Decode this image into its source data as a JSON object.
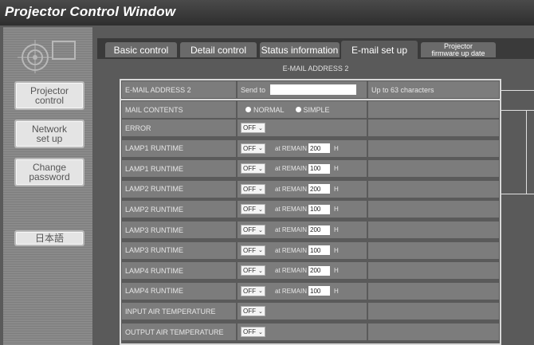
{
  "window": {
    "title": "Projector Control Window"
  },
  "sidebar": {
    "buttons": [
      {
        "label": "Projector\ncontrol"
      },
      {
        "label": "Network\nset up"
      },
      {
        "label": "Change\npassword"
      },
      {
        "label": "日本語"
      }
    ]
  },
  "tabs": [
    {
      "label": "Basic control"
    },
    {
      "label": "Detail control"
    },
    {
      "label": "Status information"
    },
    {
      "label": "E-mail set up",
      "active": true
    },
    {
      "label": "Projector\nfirmware up date"
    }
  ],
  "page": {
    "subtitle": "E-MAIL ADDRESS 2"
  },
  "address_row": {
    "label": "E-MAIL ADDRESS 2",
    "send_to_label": "Send to",
    "email_value": "",
    "hint": "Up to 63 characters"
  },
  "mail_contents": {
    "label": "MAIL CONTENTS",
    "options": [
      "NORMAL",
      "SIMPLE"
    ],
    "selected": "NORMAL"
  },
  "rows": [
    {
      "label": "ERROR",
      "value": "OFF"
    },
    {
      "label": "LAMP1 RUNTIME",
      "value": "OFF",
      "remain_label": "at REMAIN",
      "remain": "200",
      "unit": "H"
    },
    {
      "label": "LAMP1 RUNTIME",
      "value": "OFF",
      "remain_label": "at REMAIN",
      "remain": "100",
      "unit": "H"
    },
    {
      "label": "LAMP2 RUNTIME",
      "value": "OFF",
      "remain_label": "at REMAIN",
      "remain": "200",
      "unit": "H"
    },
    {
      "label": "LAMP2 RUNTIME",
      "value": "OFF",
      "remain_label": "at REMAIN",
      "remain": "100",
      "unit": "H"
    },
    {
      "label": "LAMP3 RUNTIME",
      "value": "OFF",
      "remain_label": "at REMAIN",
      "remain": "200",
      "unit": "H"
    },
    {
      "label": "LAMP3 RUNTIME",
      "value": "OFF",
      "remain_label": "at REMAIN",
      "remain": "100",
      "unit": "H"
    },
    {
      "label": "LAMP4 RUNTIME",
      "value": "OFF",
      "remain_label": "at REMAIN",
      "remain": "200",
      "unit": "H"
    },
    {
      "label": "LAMP4 RUNTIME",
      "value": "OFF",
      "remain_label": "at REMAIN",
      "remain": "100",
      "unit": "H"
    },
    {
      "label": "INPUT AIR TEMPERATURE",
      "value": "OFF"
    },
    {
      "label": "OUTPUT AIR TEMPERATURE",
      "value": "OFF"
    }
  ]
}
